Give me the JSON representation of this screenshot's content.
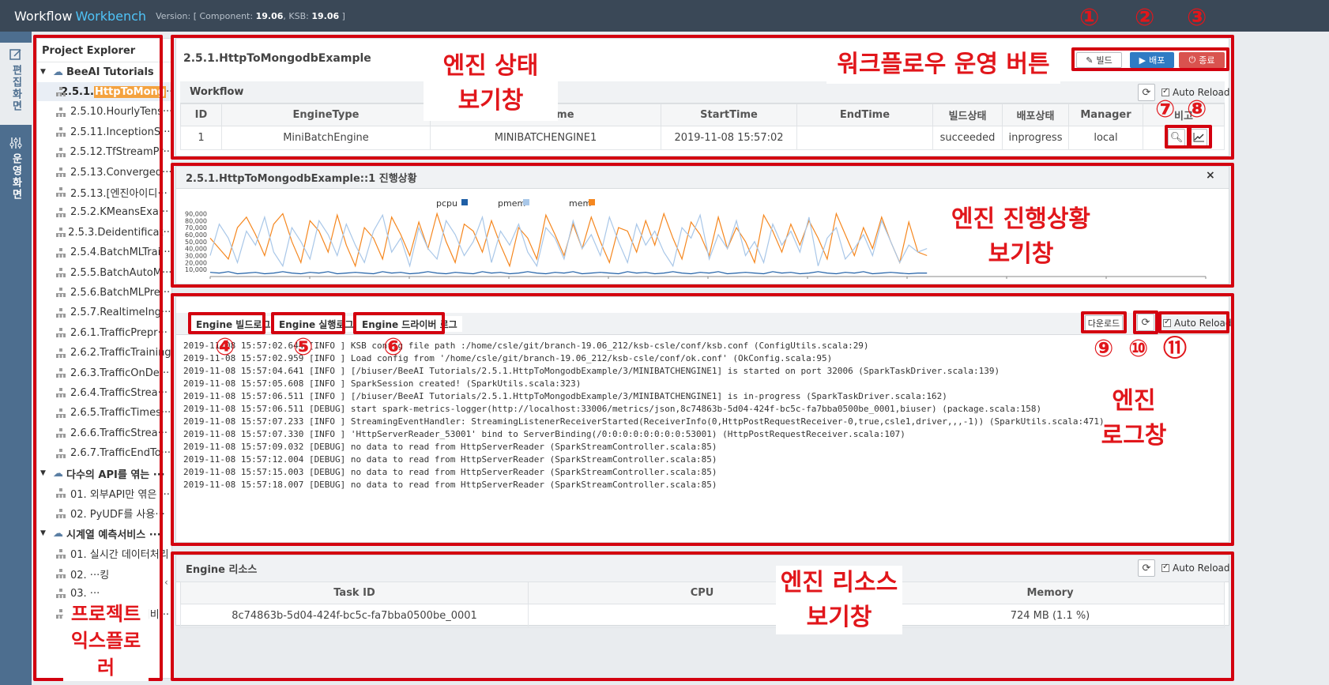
{
  "app": {
    "brand_part1": "Workflow",
    "brand_part2": "Workbench",
    "version_text": "Version: [ Component: ",
    "component_version": "19.06",
    "ksb_label": ", KSB: ",
    "ksb_version": "19.06",
    "version_close": " ]"
  },
  "rail": {
    "items": [
      {
        "label": "편집화면",
        "icon": "edit-icon",
        "active": true
      },
      {
        "label": "운영화면",
        "icon": "sliders-icon",
        "active": false
      }
    ]
  },
  "explorer": {
    "title": "Project Explorer",
    "rows": [
      {
        "type": "folder",
        "label": "BeeAI Tutorials"
      },
      {
        "type": "item",
        "prefix": "2.5.1.",
        "highlight": "HttpToMong",
        "suffix": "···",
        "selected": true
      },
      {
        "type": "item",
        "label": "2.5.10.HourlyTens···"
      },
      {
        "type": "item",
        "label": "2.5.11.InceptionS···"
      },
      {
        "type": "item",
        "label": "2.5.12.TfStreamPr···"
      },
      {
        "type": "item",
        "label": "2.5.13.Converged···"
      },
      {
        "type": "item",
        "label": "2.5.13.[엔진아이디···"
      },
      {
        "type": "item",
        "label": "2.5.2.KMeansExa···"
      },
      {
        "type": "item",
        "label": "2.5.3.Deidentificat···"
      },
      {
        "type": "item",
        "label": "2.5.4.BatchMLTrai···"
      },
      {
        "type": "item",
        "label": "2.5.5.BatchAutoM···"
      },
      {
        "type": "item",
        "label": "2.5.6.BatchMLPre···"
      },
      {
        "type": "item",
        "label": "2.5.7.RealtimeIng···"
      },
      {
        "type": "item",
        "label": "2.6.1.TrafficPrepr···"
      },
      {
        "type": "item",
        "label": "2.6.2.TrafficTraining"
      },
      {
        "type": "item",
        "label": "2.6.3.TrafficOnDe···"
      },
      {
        "type": "item",
        "label": "2.6.4.TrafficStrea···"
      },
      {
        "type": "item",
        "label": "2.6.5.TrafficTimes···"
      },
      {
        "type": "item",
        "label": "2.6.6.TrafficStrea···"
      },
      {
        "type": "item",
        "label": "2.6.7.TrafficEndTo···"
      },
      {
        "type": "folder",
        "label": "다수의 API를 엮는 ···"
      },
      {
        "type": "item",
        "label": "01. 외부API만 엮은 ···"
      },
      {
        "type": "item",
        "label": "02. PyUDF를 사용···"
      },
      {
        "type": "folder",
        "label": "시계열 예측서비스 ···"
      },
      {
        "type": "item",
        "label": "01. 실시간 데이터처리"
      },
      {
        "type": "item",
        "label": "02. ···킹"
      },
      {
        "type": "item",
        "label": "03. ···"
      },
      {
        "type": "item",
        "label": "04. 주기적 예측서비···"
      }
    ],
    "collapse_glyph": "‹"
  },
  "status_panel": {
    "title": "2.5.1.HttpToMongodbExample",
    "build_label": "빌드",
    "deploy_label": "배포",
    "stop_label": "종료",
    "workflow_header": "Workflow",
    "auto_reload": "Auto Reload",
    "columns": [
      "ID",
      "EngineType",
      "Nickname",
      "StartTime",
      "EndTime",
      "빌드상태",
      "배포상태",
      "Manager",
      "비고"
    ],
    "row": {
      "id": "1",
      "engine_type": "MiniBatchEngine",
      "nickname": "MINIBATCHENGINE1",
      "start_time": "2019-11-08 15:57:02",
      "end_time": "",
      "build_status": "succeeded",
      "deploy_status": "inprogress",
      "manager": "local"
    }
  },
  "progress_panel": {
    "title": "2.5.1.HttpToMongodbExample::1 진행상황",
    "close_glyph": "×"
  },
  "chart_data": {
    "type": "line",
    "legend": [
      "pcpu",
      "pmem",
      "mem"
    ],
    "colors": {
      "pcpu": "#1f5fa6",
      "pmem": "#a9c7e8",
      "mem": "#f5871f"
    },
    "yticks": [
      "90,000",
      "80,000",
      "70,000",
      "60,000",
      "50,000",
      "40,000",
      "30,000",
      "20,000",
      "10,000"
    ],
    "ylim": [
      0,
      95000
    ],
    "xlim": [
      0,
      100
    ],
    "series": [
      {
        "name": "mem",
        "values": [
          55000,
          40000,
          25000,
          70000,
          85000,
          60000,
          30000,
          75000,
          90000,
          50000,
          20000,
          80000,
          65000,
          35000,
          88000,
          45000,
          15000,
          70000,
          55000,
          25000,
          85000,
          60000,
          30000,
          78000,
          40000,
          90000,
          50000,
          20000,
          75000,
          65000,
          35000,
          80000,
          45000,
          15000,
          70000,
          55000,
          25000,
          88000,
          60000,
          30000,
          75000,
          40000,
          85000,
          50000,
          20000,
          70000,
          65000,
          35000,
          80000,
          45000,
          90000,
          55000,
          25000,
          78000,
          60000,
          30000,
          85000,
          40000,
          70000,
          50000,
          20000,
          88000,
          65000,
          35000,
          75000,
          45000,
          80000,
          55000,
          25000,
          90000,
          60000,
          30000,
          70000,
          40000,
          85000,
          50000,
          20000,
          78000,
          35000,
          30000
        ]
      },
      {
        "name": "pmem",
        "values": [
          30000,
          75000,
          55000,
          20000,
          65000,
          45000,
          85000,
          35000,
          15000,
          70000,
          50000,
          25000,
          80000,
          60000,
          30000,
          75000,
          45000,
          20000,
          65000,
          88000,
          35000,
          55000,
          15000,
          70000,
          40000,
          25000,
          80000,
          60000,
          30000,
          50000,
          85000,
          20000,
          65000,
          45000,
          75000,
          35000,
          15000,
          70000,
          55000,
          25000,
          80000,
          40000,
          60000,
          30000,
          85000,
          50000,
          20000,
          75000,
          45000,
          65000,
          35000,
          15000,
          70000,
          55000,
          88000,
          25000,
          60000,
          40000,
          80000,
          30000,
          50000,
          20000,
          75000,
          45000,
          65000,
          35000,
          85000,
          15000,
          55000,
          70000,
          25000,
          40000,
          60000,
          30000,
          80000,
          50000,
          20000,
          45000,
          35000,
          40000
        ]
      },
      {
        "name": "pcpu",
        "values": [
          6000,
          5000,
          7000,
          4000,
          5000,
          6000,
          4000,
          5000,
          7000,
          5000,
          4000,
          6000,
          5000,
          7000,
          4000,
          5000,
          6000,
          5000,
          4000,
          7000,
          5000,
          6000,
          4000,
          5000,
          7000,
          5000,
          4000,
          6000,
          5000,
          4000,
          7000,
          5000,
          6000,
          4000,
          5000,
          7000,
          5000,
          4000,
          6000,
          5000,
          7000,
          4000,
          5000,
          6000,
          5000,
          4000,
          7000,
          5000,
          6000,
          4000,
          5000,
          7000,
          5000,
          4000,
          6000,
          5000,
          7000,
          4000,
          5000,
          6000,
          5000,
          4000,
          7000,
          5000,
          6000,
          4000,
          5000,
          7000,
          5000,
          4000,
          6000,
          5000,
          7000,
          4000,
          5000,
          6000,
          5000,
          4000,
          5000,
          5000
        ]
      }
    ]
  },
  "log_panel": {
    "tab_build": "Engine 빌드로그",
    "tab_run": "Engine 실행로그",
    "tab_driver": "Engine 드라이버 로그",
    "download": "다운로드",
    "auto_reload": "Auto Reload",
    "lines": [
      "2019-11-08 15:57:02.644 [INFO ] KSB config file path :/home/csle/git/branch-19.06_212/ksb-csle/conf/ksb.conf (ConfigUtils.scala:29)",
      "2019-11-08 15:57:02.959 [INFO ] Load config from '/home/csle/git/branch-19.06_212/ksb-csle/conf/ok.conf' (OkConfig.scala:95)",
      "2019-11-08 15:57:04.641 [INFO ] [/biuser/BeeAI Tutorials/2.5.1.HttpToMongodbExample/3/MINIBATCHENGINE1] is started on port 32006 (SparkTaskDriver.scala:139)",
      "2019-11-08 15:57:05.608 [INFO ] SparkSession created! (SparkUtils.scala:323)",
      "2019-11-08 15:57:06.511 [INFO ] [/biuser/BeeAI Tutorials/2.5.1.HttpToMongodbExample/3/MINIBATCHENGINE1] is in-progress (SparkTaskDriver.scala:162)",
      "2019-11-08 15:57:06.511 [DEBUG] start spark-metrics-logger(http://localhost:33006/metrics/json,8c74863b-5d04-424f-bc5c-fa7bba0500be_0001,biuser) (package.scala:158)",
      "2019-11-08 15:57:07.233 [INFO ] StreamingEventHandler: StreamingListenerReceiverStarted(ReceiverInfo(0,HttpPostRequestReceiver-0,true,csle1,driver,,,-1)) (SparkUtils.scala:471)",
      "2019-11-08 15:57:07.330 [INFO ] 'HttpServerReader_53001' bind to ServerBinding(/0:0:0:0:0:0:0:0:53001) (HttpPostRequestReceiver.scala:107)",
      "2019-11-08 15:57:09.032 [DEBUG] no data to read from HttpServerReader (SparkStreamController.scala:85)",
      "2019-11-08 15:57:12.004 [DEBUG] no data to read from HttpServerReader (SparkStreamController.scala:85)",
      "2019-11-08 15:57:15.003 [DEBUG] no data to read from HttpServerReader (SparkStreamController.scala:85)",
      "2019-11-08 15:57:18.007 [DEBUG] no data to read from HttpServerReader (SparkStreamController.scala:85)"
    ]
  },
  "resource_panel": {
    "title": "Engine 리소스",
    "auto_reload": "Auto Reload",
    "columns": [
      "Task ID",
      "CPU",
      "Memory"
    ],
    "row": {
      "task_id": "8c74863b-5d04-424f-bc5c-fa7bba0500be_0001",
      "cpu": "",
      "memory": "724 MB (1.1 %)"
    }
  },
  "annotations": {
    "status_window": [
      "엔진 상태",
      "보기창"
    ],
    "workflow_buttons": "워크플로우 운영 버튼",
    "progress_window": [
      "엔진 진행상황",
      "보기창"
    ],
    "log_window": [
      "엔진",
      "로그창"
    ],
    "resource_window": [
      "엔진 리소스",
      "보기창"
    ],
    "explorer": [
      "프로젝트",
      "익스플로러"
    ],
    "n1": "①",
    "n2": "②",
    "n3": "③",
    "n4": "④",
    "n5": "⑤",
    "n6": "⑥",
    "n7": "⑦",
    "n8": "⑧",
    "n9": "⑨",
    "n10": "⑩",
    "n11": "⑪"
  },
  "colors": {
    "annotation_red": "#d3000f",
    "topbar": "#3a4857",
    "rail": "#4d6e8f",
    "deploy_blue": "#2f7bc4",
    "stop_red": "#d9534f"
  }
}
